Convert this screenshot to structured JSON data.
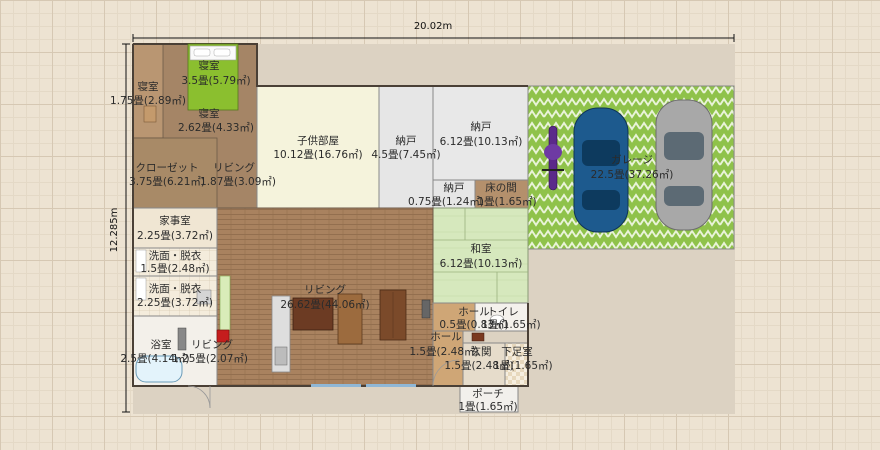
{
  "dimensions": {
    "width_label": "20.02m",
    "height_label": "12.285m"
  },
  "rooms": [
    {
      "id": "bedroom-master",
      "name": "寝室",
      "size": "3.5畳(5.79㎡)"
    },
    {
      "id": "bedroom-left",
      "name": "寝室",
      "size": "1.75畳(2.89㎡)"
    },
    {
      "id": "bedroom-lower",
      "name": "寝室",
      "size": "2.62畳(4.33㎡)"
    },
    {
      "id": "kids-room",
      "name": "子供部屋",
      "size": "10.12畳(16.76㎡)"
    },
    {
      "id": "storage-1",
      "name": "納戸",
      "size": "4.5畳(7.45㎡)"
    },
    {
      "id": "storage-2",
      "name": "納戸",
      "size": "6.12畳(10.13㎡)"
    },
    {
      "id": "storage-3",
      "name": "納戸",
      "size": "0.75畳(1.24㎡)"
    },
    {
      "id": "tokonoma",
      "name": "床の間",
      "size": "1畳(1.65㎡)"
    },
    {
      "id": "closet",
      "name": "クローゼット",
      "size": "3.75畳(6.21㎡)"
    },
    {
      "id": "living-small",
      "name": "リビング",
      "size": "1.87畳(3.09㎡)"
    },
    {
      "id": "garage",
      "name": "ガレージ",
      "size": "22.5畳(37.26㎡)"
    },
    {
      "id": "utility",
      "name": "家事室",
      "size": "2.25畳(3.72㎡)"
    },
    {
      "id": "washroom-1",
      "name": "洗面・脱衣",
      "size": "1.5畳(2.48㎡)"
    },
    {
      "id": "washroom-2",
      "name": "洗面・脱衣",
      "size": "2.25畳(3.72㎡)"
    },
    {
      "id": "washitsu",
      "name": "和室",
      "size": "6.12畳(10.13㎡)"
    },
    {
      "id": "living-main",
      "name": "リビング",
      "size": "26.62畳(44.06㎡)"
    },
    {
      "id": "hall-1",
      "name": "ホール",
      "size": "0.5畳(0.83㎡)"
    },
    {
      "id": "toilet",
      "name": "トイレ",
      "size": "1畳(1.65㎡)"
    },
    {
      "id": "bath",
      "name": "浴室",
      "size": "2.5畳(4.14㎡)"
    },
    {
      "id": "living-bath",
      "name": "リビング",
      "size": "1.25畳(2.07㎡)"
    },
    {
      "id": "hall-2",
      "name": "ホール",
      "size": "1.5畳(2.48㎡)"
    },
    {
      "id": "entrance",
      "name": "玄関",
      "size": "1.5畳(2.48㎡)"
    },
    {
      "id": "shoe-room",
      "name": "下足室",
      "size": "1畳(1.65㎡)"
    },
    {
      "id": "porch",
      "name": "ポーチ",
      "size": "1畳(1.65㎡)"
    }
  ],
  "colors": {
    "wood_floor": "#a7815f",
    "tatami": "#cfe3b5",
    "kids_floor": "#f4f3da",
    "storage_floor": "#e3e3e3",
    "garage_green": "#8fc24a",
    "tile": "#f2ead8",
    "car_blue": "#1d5a8e",
    "car_silver": "#a8a8a8"
  }
}
